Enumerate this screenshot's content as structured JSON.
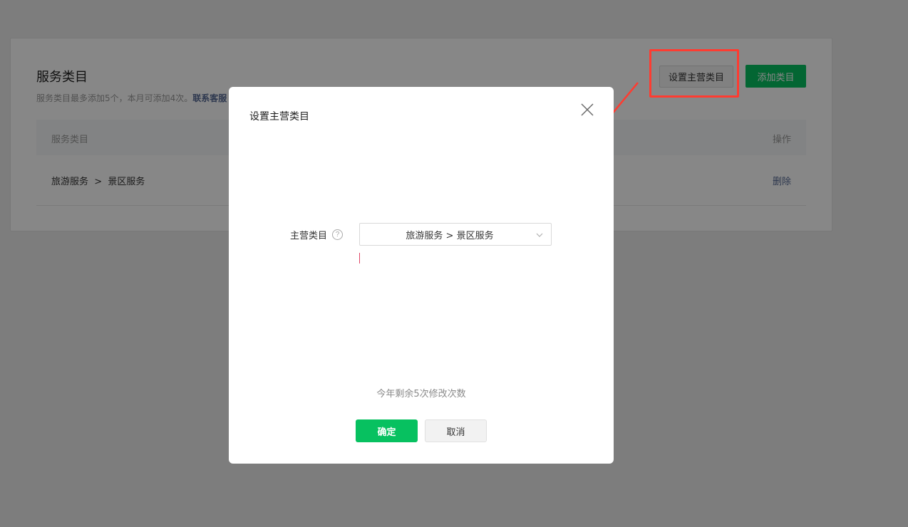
{
  "page": {
    "title": "服务类目",
    "desc_prefix": "服务类目最多添加5个，本月可添加4次。",
    "desc_link": "联系客服",
    "set_main_button": "设置主营类目",
    "add_button": "添加类目"
  },
  "table": {
    "headers": {
      "category": "服务类目",
      "operation": "操作"
    },
    "rows": [
      {
        "category": "旅游服务  >  景区服务",
        "operation": "删除"
      }
    ]
  },
  "dialog": {
    "title": "设置主营类目",
    "field_label": "主营类目",
    "help_icon": "?",
    "select_value": "旅游服务 > 景区服务",
    "remaining_text": "今年剩余5次修改次数",
    "confirm_label": "确定",
    "cancel_label": "取消"
  },
  "colors": {
    "accent": "#07c160",
    "link": "#576b95",
    "annotation": "#ff3b30"
  },
  "icons": [
    "close-icon",
    "help-icon",
    "chevron-down-icon"
  ]
}
